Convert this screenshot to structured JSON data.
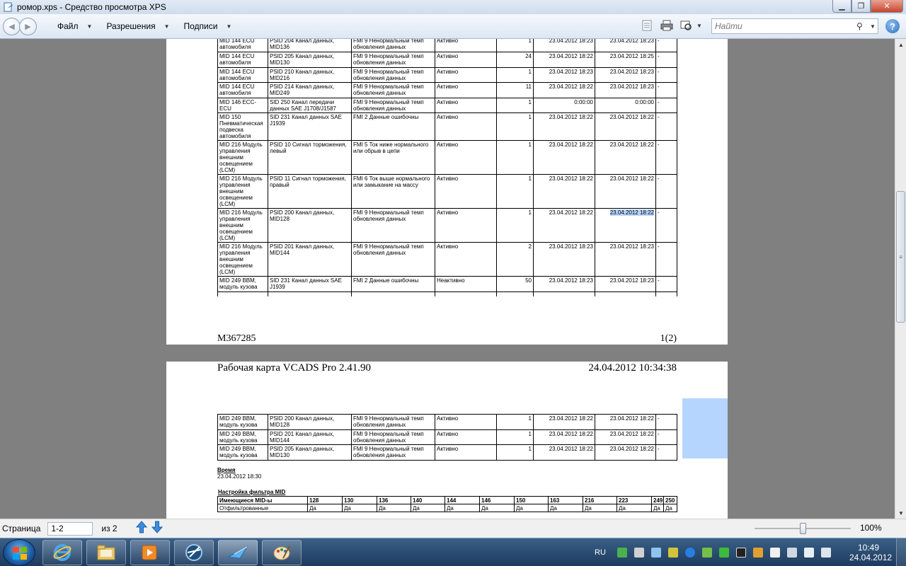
{
  "window": {
    "title": "ромор.xps - Средство просмотра XPS"
  },
  "menu": {
    "items": [
      "Файл",
      "Разрешения",
      "Подписи"
    ]
  },
  "search": {
    "placeholder": "Найти"
  },
  "page1": {
    "rows": [
      [
        "MID 144 ECU автомобиля",
        "PSID 204 Канал данных, MID136",
        "FMI 9 Ненормальный темп обновления данных",
        "Активно",
        "1",
        "23.04.2012 18:23",
        "23.04.2012 18:23",
        "-"
      ],
      [
        "MID 144 ECU автомобиля",
        "PSID 205 Канал данных, MID130",
        "FMI 9 Ненормальный темп обновления данных",
        "Активно",
        "24",
        "23.04.2012 18:22",
        "23.04.2012 18:25",
        "-"
      ],
      [
        "MID 144 ECU автомобиля",
        "PSID 210 Канал данных, MID216",
        "FMI 9 Ненормальный темп обновления данных",
        "Активно",
        "1",
        "23.04.2012 18:23",
        "23.04.2012 18:23",
        "-"
      ],
      [
        "MID 144 ECU автомобиля",
        "PSID 214 Канал данных, MID249",
        "FMI 9 Ненормальный темп обновления данных",
        "Активно",
        "11",
        "23.04.2012 18:22",
        "23.04.2012 18:23",
        "-"
      ],
      [
        "MID 146 ECC-ECU",
        "SID 250 Канал передачи данных SAE J1708/J1587",
        "FMI 9 Ненормальный темп обновления данных",
        "Активно",
        "1",
        "0:00:00",
        "0:00:00",
        "-"
      ],
      [
        "MID 150 Пневматическая подвеска автомобиля",
        "SID 231 Канал данных SAE J1939",
        "FMI 2 Данные ошибочны",
        "Активно",
        "1",
        "23.04.2012 18:22",
        "23.04.2012 18:22",
        "-"
      ],
      [
        "MID 216 Модуль управления внешним освещением (LCM)",
        "PSID 10 Сигнал торможения, левый",
        "FMI 5 Ток ниже нормального или обрыв в цепи",
        "Активно",
        "1",
        "23.04.2012 18:22",
        "23.04.2012 18:22",
        "-"
      ],
      [
        "MID 216 Модуль управления внешним освещением (LCM)",
        "PSID 11 Сигнал торможения, правый",
        "FMI 6 Ток выше нормального или замыкание на массу",
        "Активно",
        "1",
        "23.04.2012 18:22",
        "23.04.2012 18:22",
        "-"
      ],
      [
        "MID 216 Модуль управления внешним освещением (LCM)",
        "PSID 200 Канал данных, MID128",
        "FMI 9 Ненормальный темп обновления данных",
        "Активно",
        "1",
        "23.04.2012 18:22",
        "23.04.2012 18:22",
        "-"
      ],
      [
        "MID 216 Модуль управления внешним освещением (LCM)",
        "PSID 201 Канал данных, MID144",
        "FMI 9 Ненормальный темп обновления данных",
        "Активно",
        "2",
        "23.04.2012 18:23",
        "23.04.2012 18:23",
        "-"
      ],
      [
        "MID 249 BBM, модуль кузова",
        "SID 231 Канал данных SAE J1939",
        "FMI 2 Данные ошибочны",
        "Неактивно",
        "50",
        "23.04.2012 18:23",
        "23.04.2012 18:23",
        "-"
      ]
    ],
    "footer_left": "M367285",
    "footer_right": "1(2)"
  },
  "page2": {
    "header_left": "Рабочая карта VCADS Pro 2.41.90",
    "header_right": "24.04.2012 10:34:38",
    "rows": [
      [
        "MID 249 BBM, модуль кузова",
        "PSID 200 Канал данных, MID128",
        "FMI 9 Ненормальный темп обновления данных",
        "Активно",
        "1",
        "23.04.2012 18:22",
        "23.04.2012 18:22",
        "-"
      ],
      [
        "MID 249 BBM, модуль кузова",
        "PSID 201 Канал данных, MID144",
        "FMI 9 Ненормальный темп обновления данных",
        "Активно",
        "1",
        "23.04.2012 18:22",
        "23.04.2012 18:22",
        "-"
      ],
      [
        "MID 249 BBM, модуль кузова",
        "PSID 205 Канал данных, MID130",
        "FMI 9 Ненормальный темп обновления данных",
        "Активно",
        "1",
        "23.04.2012 18:22",
        "23.04.2012 18:22",
        "-"
      ]
    ],
    "time_title": "Время",
    "time_value": "23.04.2012 18:30",
    "filter_title": "Настройка фильтра MID",
    "filter_head": [
      "Имеющиеся MID-ы",
      "128",
      "130",
      "136",
      "140",
      "144",
      "146",
      "150",
      "163",
      "216",
      "223",
      "249",
      "250"
    ],
    "filter_row": [
      "Отфильтрованные",
      "Да",
      "Да",
      "Да",
      "Да",
      "Да",
      "Да",
      "Да",
      "Да",
      "Да",
      "Да",
      "Да",
      "Да"
    ]
  },
  "status": {
    "page_label": "Страница",
    "page_value": "1-2",
    "of_label": "из 2",
    "zoom": "100%",
    "zoom_level": 0.5
  },
  "taskbar": {
    "lang": "RU",
    "time": "10:49",
    "date": "24.04.2012"
  }
}
